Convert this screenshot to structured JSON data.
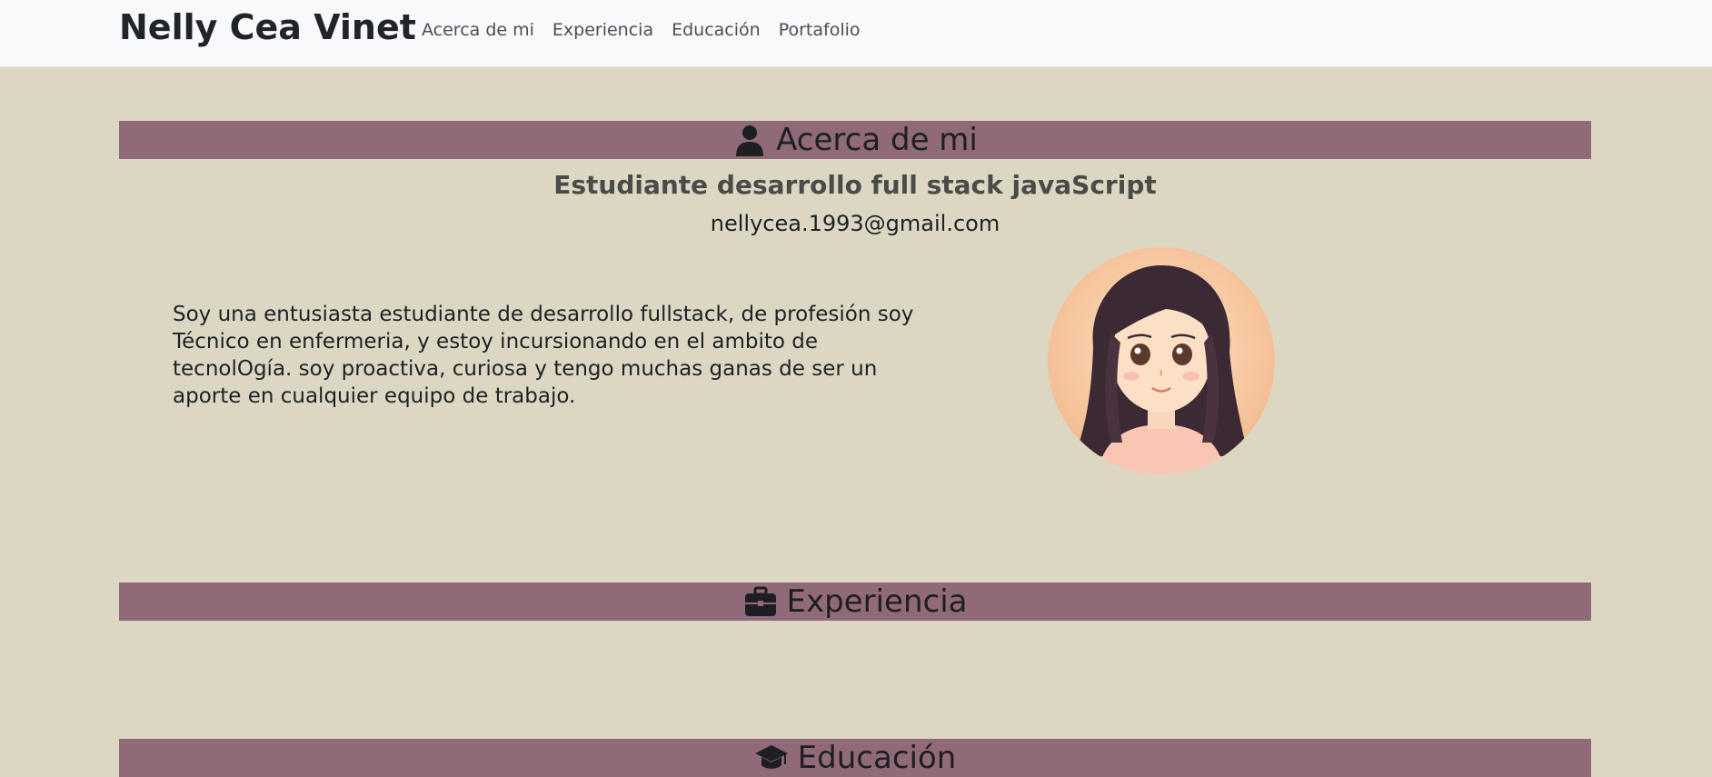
{
  "navbar": {
    "brand": "Nelly Cea Vinet",
    "links": [
      "Acerca de mi",
      "Experiencia",
      "Educación",
      "Portafolio"
    ]
  },
  "about": {
    "heading": "Acerca de mi",
    "heading_icon": "user-icon",
    "subtitle": "Estudiante desarrollo full stack javaScript",
    "email": "nellycea.1993@gmail.com",
    "description": "Soy una entusiasta estudiante de desarrollo fullstack, de profesión soy Técnico en enfermeria, y estoy incursionando en el ambito de tecnolOgía. soy proactiva, curiosa y tengo muchas ganas de ser un aporte en cualquier equipo de trabajo.",
    "avatar_icon": "avatar-illustration"
  },
  "experience": {
    "heading": "Experiencia",
    "heading_icon": "briefcase-icon"
  },
  "education": {
    "heading": "Educación",
    "heading_icon": "graduation-cap-icon"
  },
  "colors": {
    "background": "#dbd7c3",
    "navbar": "#f8f9fb",
    "section_bar": "#916a7a",
    "text": "#1f2125"
  }
}
